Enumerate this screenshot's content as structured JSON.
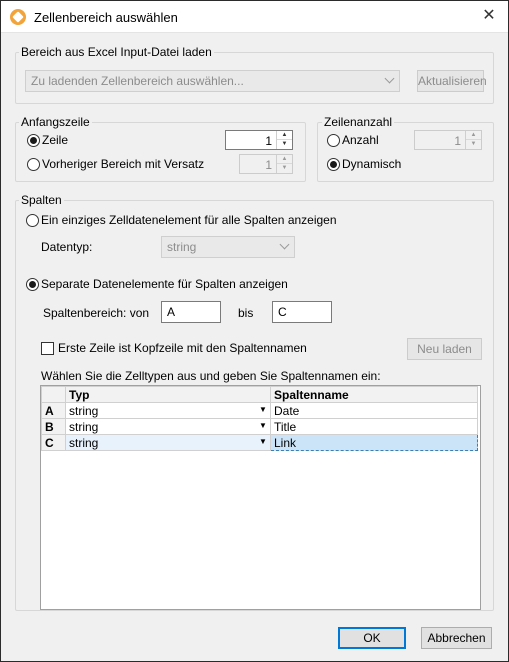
{
  "window": {
    "title": "Zellenbereich auswählen",
    "icon": "altova-app-icon",
    "close_glyph": "✕"
  },
  "excel_group": {
    "legend": "Bereich aus Excel Input-Datei laden",
    "range_combo": "Zu ladenden Zellenbereich auswählen...",
    "refresh_button": "Aktualisieren"
  },
  "start_row_group": {
    "legend": "Anfangszeile",
    "row_label": "Zeile",
    "row_value": "1",
    "row_selected": true,
    "offset_label": "Vorheriger Bereich mit Versatz",
    "offset_value": "1",
    "offset_selected": false
  },
  "row_count_group": {
    "legend": "Zeilenanzahl",
    "count_label": "Anzahl",
    "count_value": "1",
    "count_selected": false,
    "dynamic_label": "Dynamisch",
    "dynamic_selected": true
  },
  "columns_group": {
    "legend": "Spalten",
    "single_label": "Ein einziges Zelldatenelement für alle Spalten anzeigen",
    "single_selected": false,
    "datatype_label": "Datentyp:",
    "datatype_value": "string",
    "separate_label": "Separate Datenelemente für Spalten anzeigen",
    "separate_selected": true,
    "range_from_label": "Spaltenbereich: von",
    "range_from_value": "A",
    "range_to_label": "bis",
    "range_to_value": "C",
    "header_checkbox_label": "Erste Zeile ist Kopfzeile mit den Spaltennamen",
    "header_checkbox_checked": false,
    "reload_button": "Neu laden",
    "grid_instruction": "Wählen Sie die Zelltypen aus und geben Sie Spaltennamen ein:",
    "grid": {
      "headers": [
        "",
        "Typ",
        "Spaltenname"
      ],
      "rows": [
        {
          "col": "A",
          "type": "string",
          "name": "Date"
        },
        {
          "col": "B",
          "type": "string",
          "name": "Title"
        },
        {
          "col": "C",
          "type": "string",
          "name": "Link"
        }
      ],
      "selected_row": 2,
      "dropdown_glyph": "▼"
    }
  },
  "footer": {
    "ok_button": "OK",
    "cancel_button": "Abbrechen"
  },
  "colors": {
    "dialog_bg": "#f0f0f0",
    "selection": "#cce4f7",
    "focus_border": "#0078d7",
    "icon_orange": "#f2a33a"
  }
}
